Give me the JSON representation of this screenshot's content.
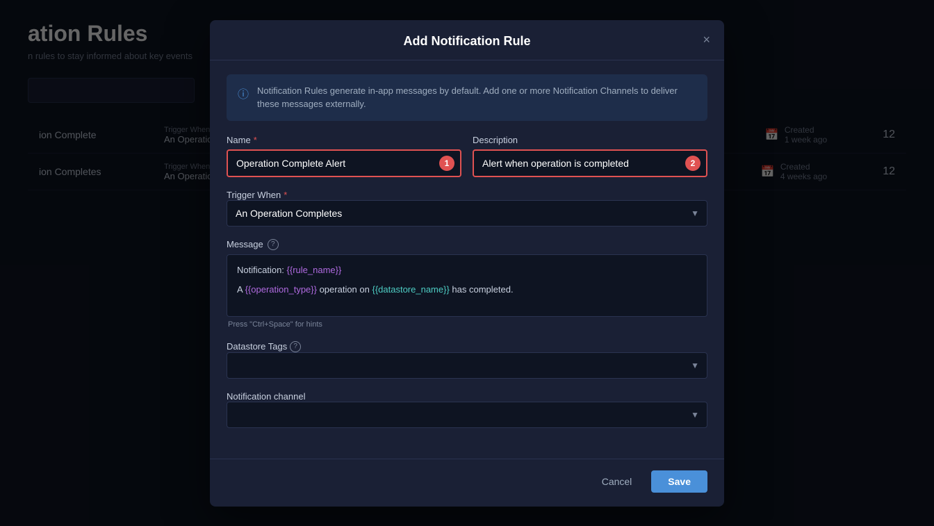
{
  "page": {
    "title": "ation Rules",
    "subtitle": "n rules to stay informed about key events",
    "page_number": "12"
  },
  "background_rows": [
    {
      "name": "ion Complete",
      "trigger_label": "Trigger When",
      "trigger_val": "An Operation",
      "created_label": "Created",
      "created_val": "1 week ago"
    },
    {
      "name": "ion Completes",
      "trigger_label": "Trigger When",
      "trigger_val": "An Operation",
      "created_label": "Created",
      "created_val": "4 weeks ago"
    }
  ],
  "modal": {
    "title": "Add Notification Rule",
    "close_label": "×",
    "info_text": "Notification Rules generate in-app messages by default. Add one or more Notification Channels to deliver these messages externally.",
    "name_label": "Name",
    "name_required": "●",
    "name_value": "Operation Complete Alert",
    "name_badge": "1",
    "description_label": "Description",
    "description_value": "Alert when operation is completed",
    "description_badge": "2",
    "trigger_label": "Trigger When",
    "trigger_required": "●",
    "trigger_value": "An Operation Completes",
    "message_label": "Message",
    "message_line1_prefix": "Notification: ",
    "message_line1_var": "{{rule_name}}",
    "message_line2_prefix": "A ",
    "message_line2_var1": "{{operation_type}}",
    "message_line2_mid": " operation on ",
    "message_line2_var2": "{{datastore_name}}",
    "message_line2_suffix": " has completed.",
    "message_hint": "Press \"Ctrl+Space\" for hints",
    "datastore_label": "Datastore Tags",
    "notification_channel_label": "Notification channel",
    "cancel_label": "Cancel",
    "save_label": "Save"
  }
}
